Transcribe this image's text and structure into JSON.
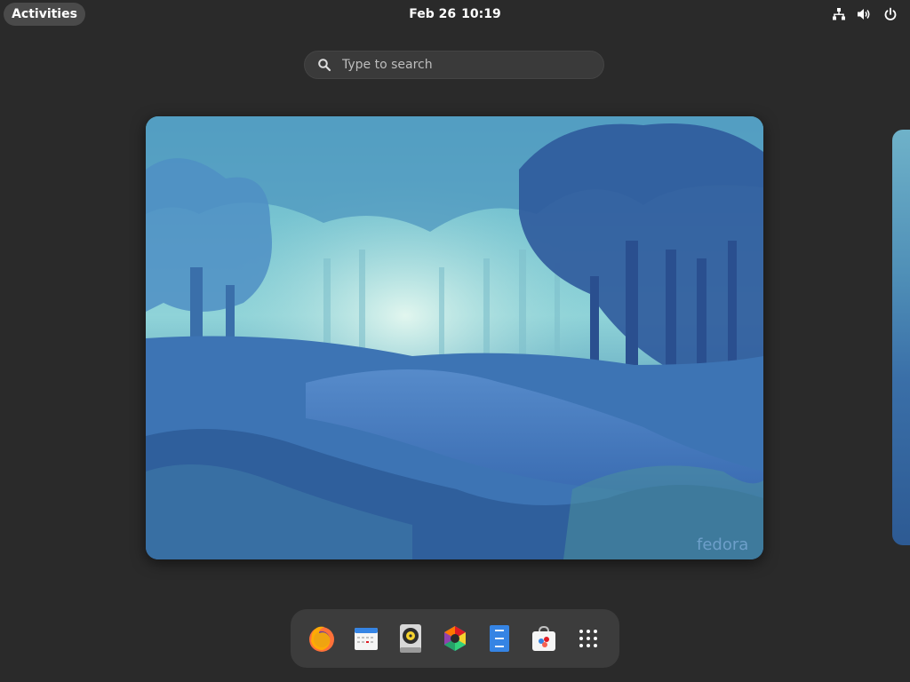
{
  "topbar": {
    "activities_label": "Activities",
    "date": "Feb 26",
    "time": "10:19",
    "tray_icons": [
      "network-icon",
      "volume-icon",
      "power-icon"
    ]
  },
  "search": {
    "placeholder": "Type to search",
    "icon": "search-icon"
  },
  "workspace": {
    "watermark": "fedora"
  },
  "dock": {
    "items": [
      {
        "name": "firefox",
        "icon": "firefox-icon"
      },
      {
        "name": "calendar",
        "icon": "calendar-icon"
      },
      {
        "name": "rhythmbox",
        "icon": "rhythmbox-icon"
      },
      {
        "name": "photos",
        "icon": "photos-icon"
      },
      {
        "name": "files",
        "icon": "files-icon"
      },
      {
        "name": "software",
        "icon": "software-icon"
      },
      {
        "name": "show-apps",
        "icon": "app-grid-icon"
      }
    ]
  },
  "colors": {
    "background": "#2a2a2a",
    "panel_pill": "#4a4a4a",
    "dock": "#3c3c3c",
    "search": "#3a3a3a"
  }
}
